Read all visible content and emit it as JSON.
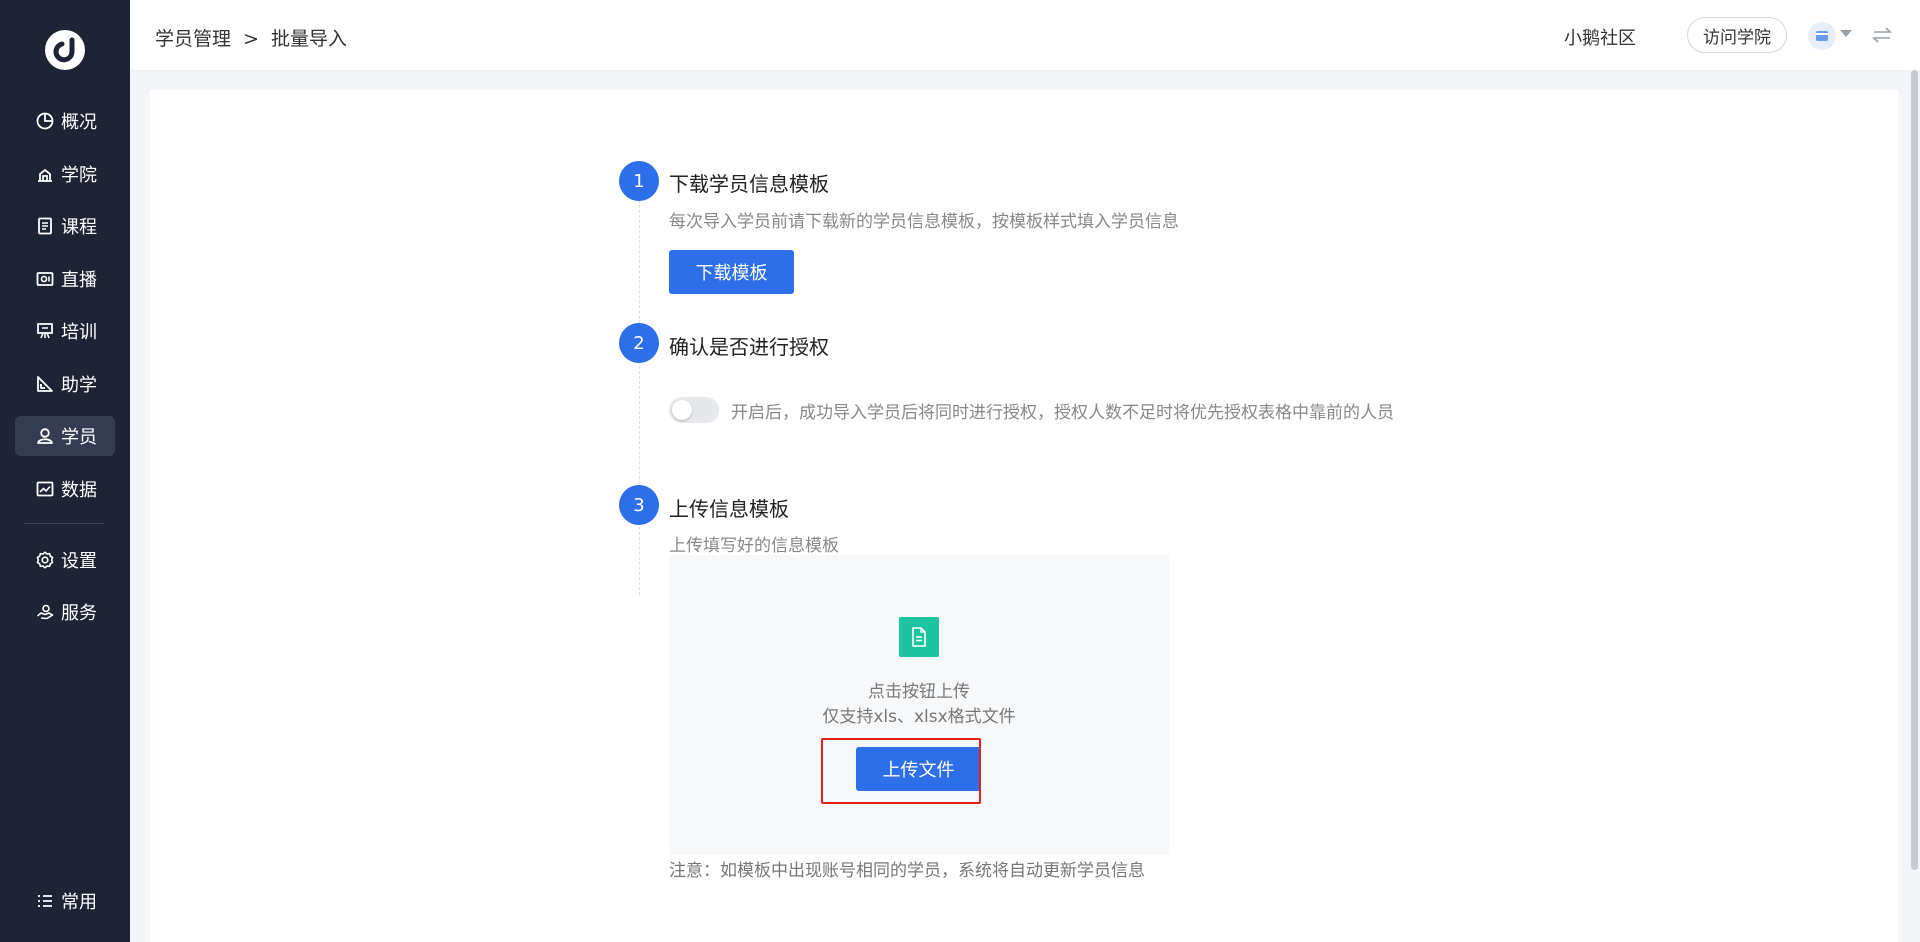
{
  "sidebar": {
    "items": [
      {
        "label": "概况",
        "icon": "dashboard-icon"
      },
      {
        "label": "学院",
        "icon": "academy-icon"
      },
      {
        "label": "课程",
        "icon": "course-icon"
      },
      {
        "label": "直播",
        "icon": "live-icon"
      },
      {
        "label": "培训",
        "icon": "training-icon"
      },
      {
        "label": "助学",
        "icon": "assist-icon"
      },
      {
        "label": "学员",
        "icon": "student-icon"
      },
      {
        "label": "数据",
        "icon": "data-icon"
      },
      {
        "label": "设置",
        "icon": "settings-icon"
      },
      {
        "label": "服务",
        "icon": "service-icon"
      }
    ],
    "active": "学员",
    "bottom_label": "常用"
  },
  "header": {
    "breadcrumb": [
      "学员管理",
      ">",
      "批量导入"
    ],
    "community": "小鹅社区",
    "visit_button": "访问学院"
  },
  "steps": [
    {
      "number": "1",
      "title": "下载学员信息模板",
      "desc": "每次导入学员前请下载新的学员信息模板，按模板样式填入学员信息",
      "button": "下载模板"
    },
    {
      "number": "2",
      "title": "确认是否进行授权",
      "toggle_on": false,
      "toggle_text": "开启后，成功导入学员后将同时进行授权，授权人数不足时将优先授权表格中靠前的人员"
    },
    {
      "number": "3",
      "title": "上传信息模板",
      "desc": "上传填写好的信息模板",
      "upload_hint_1": "点击按钮上传",
      "upload_hint_2": "仅支持xls、xlsx格式文件",
      "button": "上传文件",
      "note": "注意：如模板中出现账号相同的学员，系统将自动更新学员信息"
    }
  ],
  "colors": {
    "sidebar_bg": "#1f2434",
    "primary": "#2d6fe8",
    "file_icon": "#1ec49f",
    "highlight": "#e02020"
  }
}
